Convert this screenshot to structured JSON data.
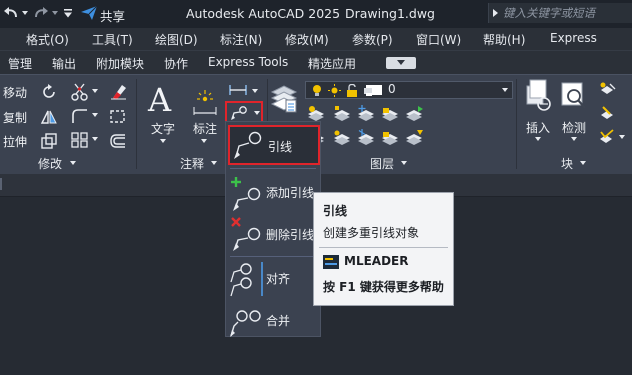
{
  "titlebar": {
    "share_label": "共享",
    "app_title": "Autodesk AutoCAD 2025",
    "document": "Drawing1.dwg",
    "search_placeholder": "键入关键字或短语"
  },
  "menu": [
    "格式(O)",
    "工具(T)",
    "绘图(D)",
    "标注(N)",
    "修改(M)",
    "参数(P)",
    "窗口(W)",
    "帮助(H)",
    "Express"
  ],
  "ribbon_tabs": [
    "管理",
    "输出",
    "附加模块",
    "协作",
    "Express Tools",
    "精选应用"
  ],
  "modify_panel": {
    "title": "修改",
    "tools": [
      "移动",
      "复制",
      "拉伸"
    ]
  },
  "annotation_panel": {
    "title": "注释",
    "text_label": "文字",
    "dim_label": "标注"
  },
  "layers_panel": {
    "title": "图层",
    "current_layer": "0",
    "layer_props_label": "图层"
  },
  "block_panel": {
    "title": "块",
    "insert_label": "插入",
    "inspect_label": "检测"
  },
  "colors": {
    "accent_red": "#e0242b",
    "layer_yellow": "#f2c200",
    "add_green": "#3cc24a",
    "remove_red": "#e03030"
  },
  "leader_menu": {
    "items": [
      "引线",
      "添加引线",
      "删除引线",
      "对齐",
      "合并"
    ]
  },
  "tooltip": {
    "title": "引线",
    "description": "创建多重引线对象",
    "command": "MLEADER",
    "help": "按 F1 键获得更多帮助"
  }
}
